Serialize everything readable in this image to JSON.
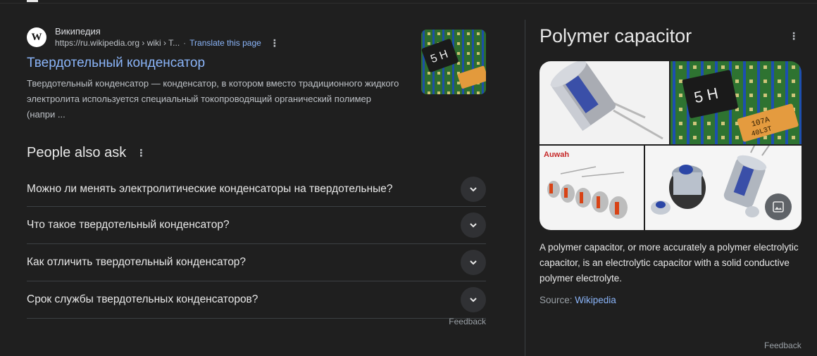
{
  "result": {
    "favicon_letter": "W",
    "site_name": "Википедия",
    "url": "https://ru.wikipedia.org › wiki › T...",
    "separator": "·",
    "translate_label": "Translate this page",
    "title": "Твердотельный конденсатор",
    "snippet": "Твердотельный конденсатор — конденсатор, в котором вместо традиционного жидкого электролита используется специальный токопроводящий органический полимер (напри ..."
  },
  "paa": {
    "title": "People also ask",
    "questions": [
      "Можно ли менять электролитические конденсаторы на твердотельные?",
      "Что такое твердотельный конденсатор?",
      "Как отличить твердотельный конденсатор?",
      "Срок службы твердотельных конденсаторов?"
    ],
    "feedback": "Feedback"
  },
  "knowledge_panel": {
    "title": "Polymer capacitor",
    "description": "A polymer capacitor, or more accurately a polymer electrolytic capacitor, is an electrolytic capacitor with a solid conductive polymer electrolyte.",
    "source_label": "Source:",
    "source_link": "Wikipedia",
    "feedback": "Feedback",
    "image_brand_text": "Auwah",
    "image_cap_text_1": "107A",
    "image_cap_text_2": "40L3T",
    "image_cap_text_3": "5 H"
  },
  "colors": {
    "background": "#1f1f1f",
    "link": "#8ab4f8",
    "text": "#e8e8e8",
    "muted": "#bdc1c6",
    "divider": "#3c4043"
  },
  "icons": [
    "wikipedia-favicon-icon",
    "more-vert-icon",
    "chevron-down-icon",
    "images-icon"
  ]
}
